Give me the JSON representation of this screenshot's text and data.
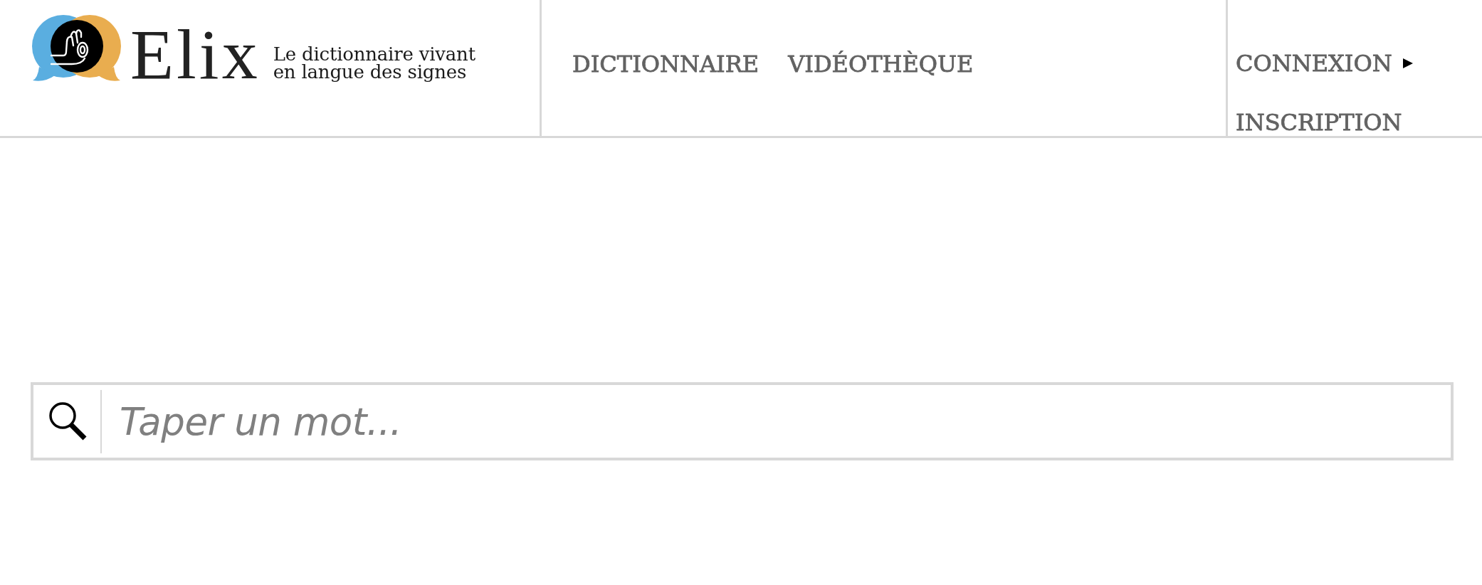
{
  "header": {
    "logo": {
      "name": "Elix",
      "tagline": [
        "Le dictionnaire vivant",
        "en langue des signes"
      ]
    },
    "nav": [
      {
        "label": "DICTIONNAIRE"
      },
      {
        "label": "VIDÉOTHÈQUE"
      }
    ],
    "account": [
      {
        "label": "CONNEXION",
        "kind": "menu"
      },
      {
        "label": "INSCRIPTION",
        "kind": "link"
      }
    ]
  },
  "search": {
    "placeholder": "Taper un mot..."
  }
}
